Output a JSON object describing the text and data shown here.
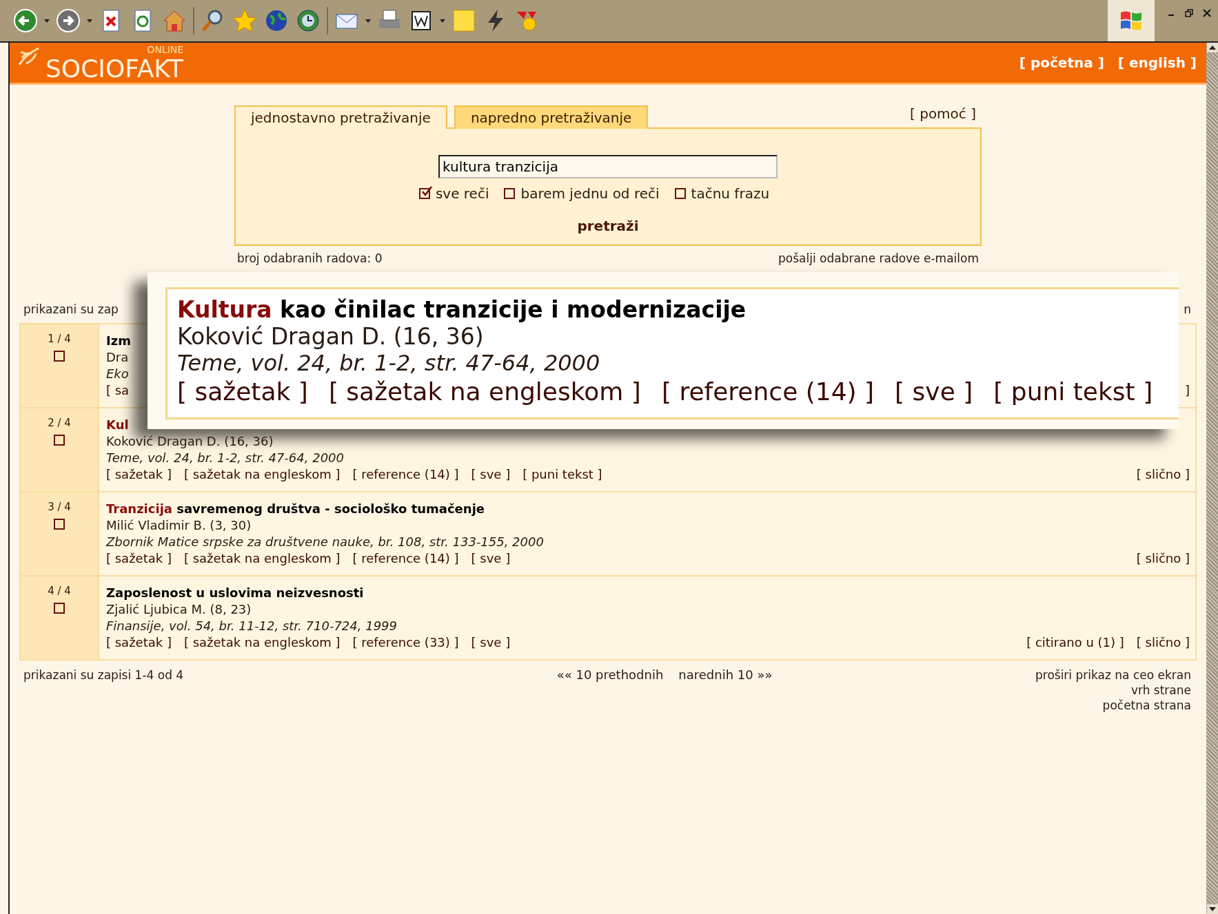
{
  "header": {
    "logo_text": "SOCIOFAKT",
    "logo_superscript": "ONLINE",
    "links": [
      "[ početna ]",
      "[ english ]"
    ]
  },
  "search": {
    "tabs": [
      {
        "label": "jednostavno pretraživanje",
        "selected": true
      },
      {
        "label": "napredno pretraživanje",
        "selected": false
      }
    ],
    "help": "[ pomoć ]",
    "query": "kultura tranzicija",
    "options": [
      {
        "label": "sve reči",
        "checked": true
      },
      {
        "label": "barem jednu od reči",
        "checked": false
      },
      {
        "label": "tačnu frazu",
        "checked": false
      }
    ],
    "button": "pretraži",
    "selected_count": "broj odabranih radova: 0",
    "email_link": "pošalji odabrane radove e-mailom"
  },
  "results": {
    "summary": "prikazani su zap",
    "summary_right": "n",
    "rows": [
      {
        "index": "1 / 4",
        "checked": false,
        "highlight": "",
        "title": "Izm",
        "author": "Dra",
        "source": "Eko",
        "links": [
          "[ sa"
        ],
        "right_links": [
          "]"
        ]
      },
      {
        "index": "2 / 4",
        "checked": false,
        "highlight": "Kul",
        "title": "",
        "author": "Koković Dragan D. (16, 36)",
        "source": "Teme, vol. 24, br. 1-2, str. 47-64, 2000",
        "links": [
          "[ sažetak ]",
          "[ sažetak na engleskom ]",
          "[ reference (14) ]",
          "[ sve ]",
          "[ puni tekst ]"
        ],
        "right_links": [
          "[ slično ]"
        ]
      },
      {
        "index": "3 / 4",
        "checked": false,
        "highlight": "Tranzicija",
        "title": " savremenog društva - sociološko tumačenje",
        "author": "Milić Vladimir B. (3, 30)",
        "source": "Zbornik Matice srpske za društvene nauke, br. 108, str. 133-155, 2000",
        "links": [
          "[ sažetak ]",
          "[ sažetak na engleskom ]",
          "[ reference (14) ]",
          "[ sve ]"
        ],
        "right_links": [
          "[ slično ]"
        ]
      },
      {
        "index": "4 / 4",
        "checked": false,
        "highlight": "",
        "title": "Zaposlenost u uslovima neizvesnosti",
        "author": "Zjalić Ljubica M. (8, 23)",
        "source": "Finansije, vol. 54, br. 11-12, str. 710-724, 1999",
        "links": [
          "[ sažetak ]",
          "[ sažetak na engleskom ]",
          "[ reference (33) ]",
          "[ sve ]"
        ],
        "right_links": [
          "[ citirano u (1) ]",
          "[ slično ]"
        ]
      }
    ]
  },
  "magnifier": {
    "highlight": "Kultura",
    "title": " kao činilac tranzicije i modernizacije",
    "author": "Koković Dragan D. (16, 36)",
    "source": "Teme, vol. 24, br. 1-2, str. 47-64, 2000",
    "links": [
      "[ sažetak ]",
      "[ sažetak na engleskom ]",
      "[ reference (14) ]",
      "[ sve ]",
      "[ puni tekst ]"
    ]
  },
  "footer": {
    "summary": "prikazani su zapisi 1-4 od 4",
    "prev": "«« 10 prethodnih",
    "next": "narednih 10 »»",
    "right_links": [
      "proširi prikaz na ceo ekran",
      "vrh strane",
      "početna strana"
    ]
  }
}
